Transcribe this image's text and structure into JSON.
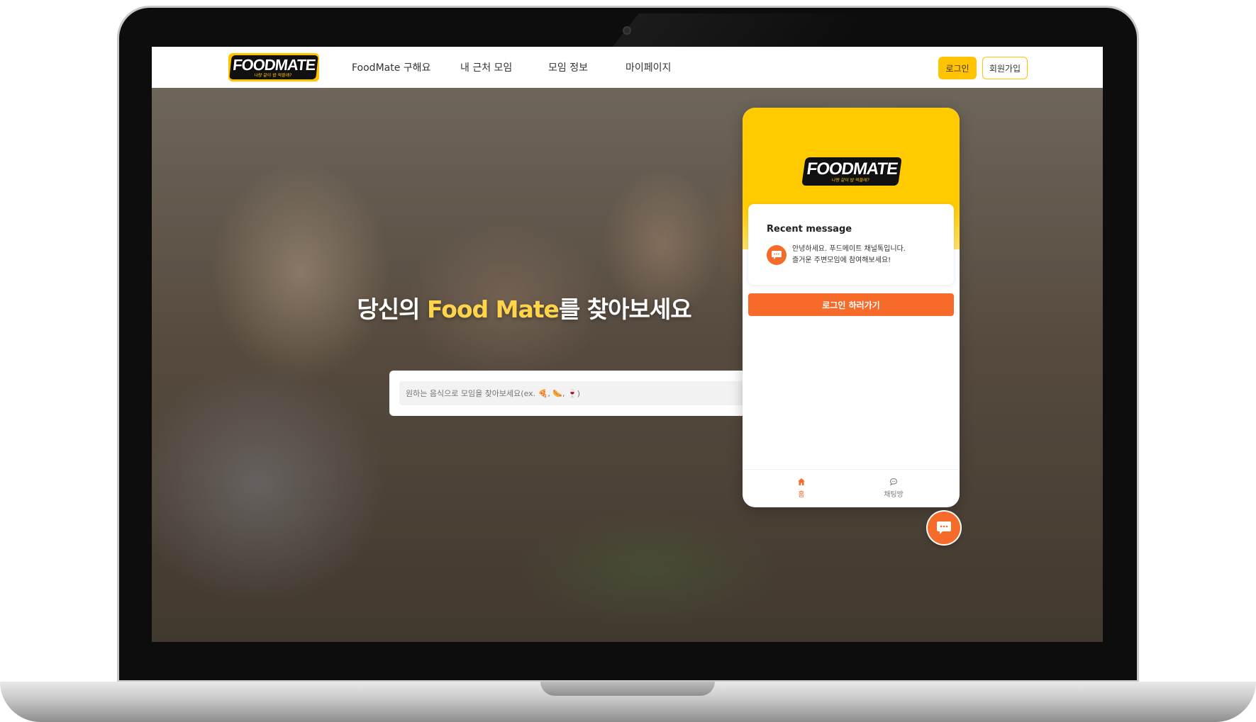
{
  "header": {
    "logo_text": "FOODMATE",
    "logo_tagline": "나랑 같이 밥 먹을래?",
    "nav": [
      {
        "label": "FoodMate 구해요"
      },
      {
        "label": "내 근처 모임"
      },
      {
        "label": "모임 정보"
      },
      {
        "label": "마이페이지"
      }
    ],
    "login_label": "로그인",
    "signup_label": "회원가입"
  },
  "hero": {
    "title_prefix": "당신의 ",
    "title_highlight": "Food Mate",
    "title_suffix": "를 찾아보세요",
    "search_placeholder": "원하는 음식으로 모임을 찾아보세요(ex. 🍕, 🌭, 🍷)"
  },
  "chat": {
    "logo_text": "FOODMATE",
    "logo_tagline": "나랑 같이 밥 먹을래?",
    "recent_title": "Recent message",
    "recent_line1": "안녕하세요. 푸드메이트 채널톡입니다.",
    "recent_line2": "즐거운 주변모임에 참여해보세요!",
    "login_button": "로그인 하러가기",
    "tabs": [
      {
        "label": "홈",
        "icon": "home-icon"
      },
      {
        "label": "채팅방",
        "icon": "chat-bubble-icon"
      }
    ]
  },
  "colors": {
    "brand_yellow": "#ffc300",
    "accent_orange": "#f66a2a",
    "highlight_text": "#ffd34a"
  }
}
